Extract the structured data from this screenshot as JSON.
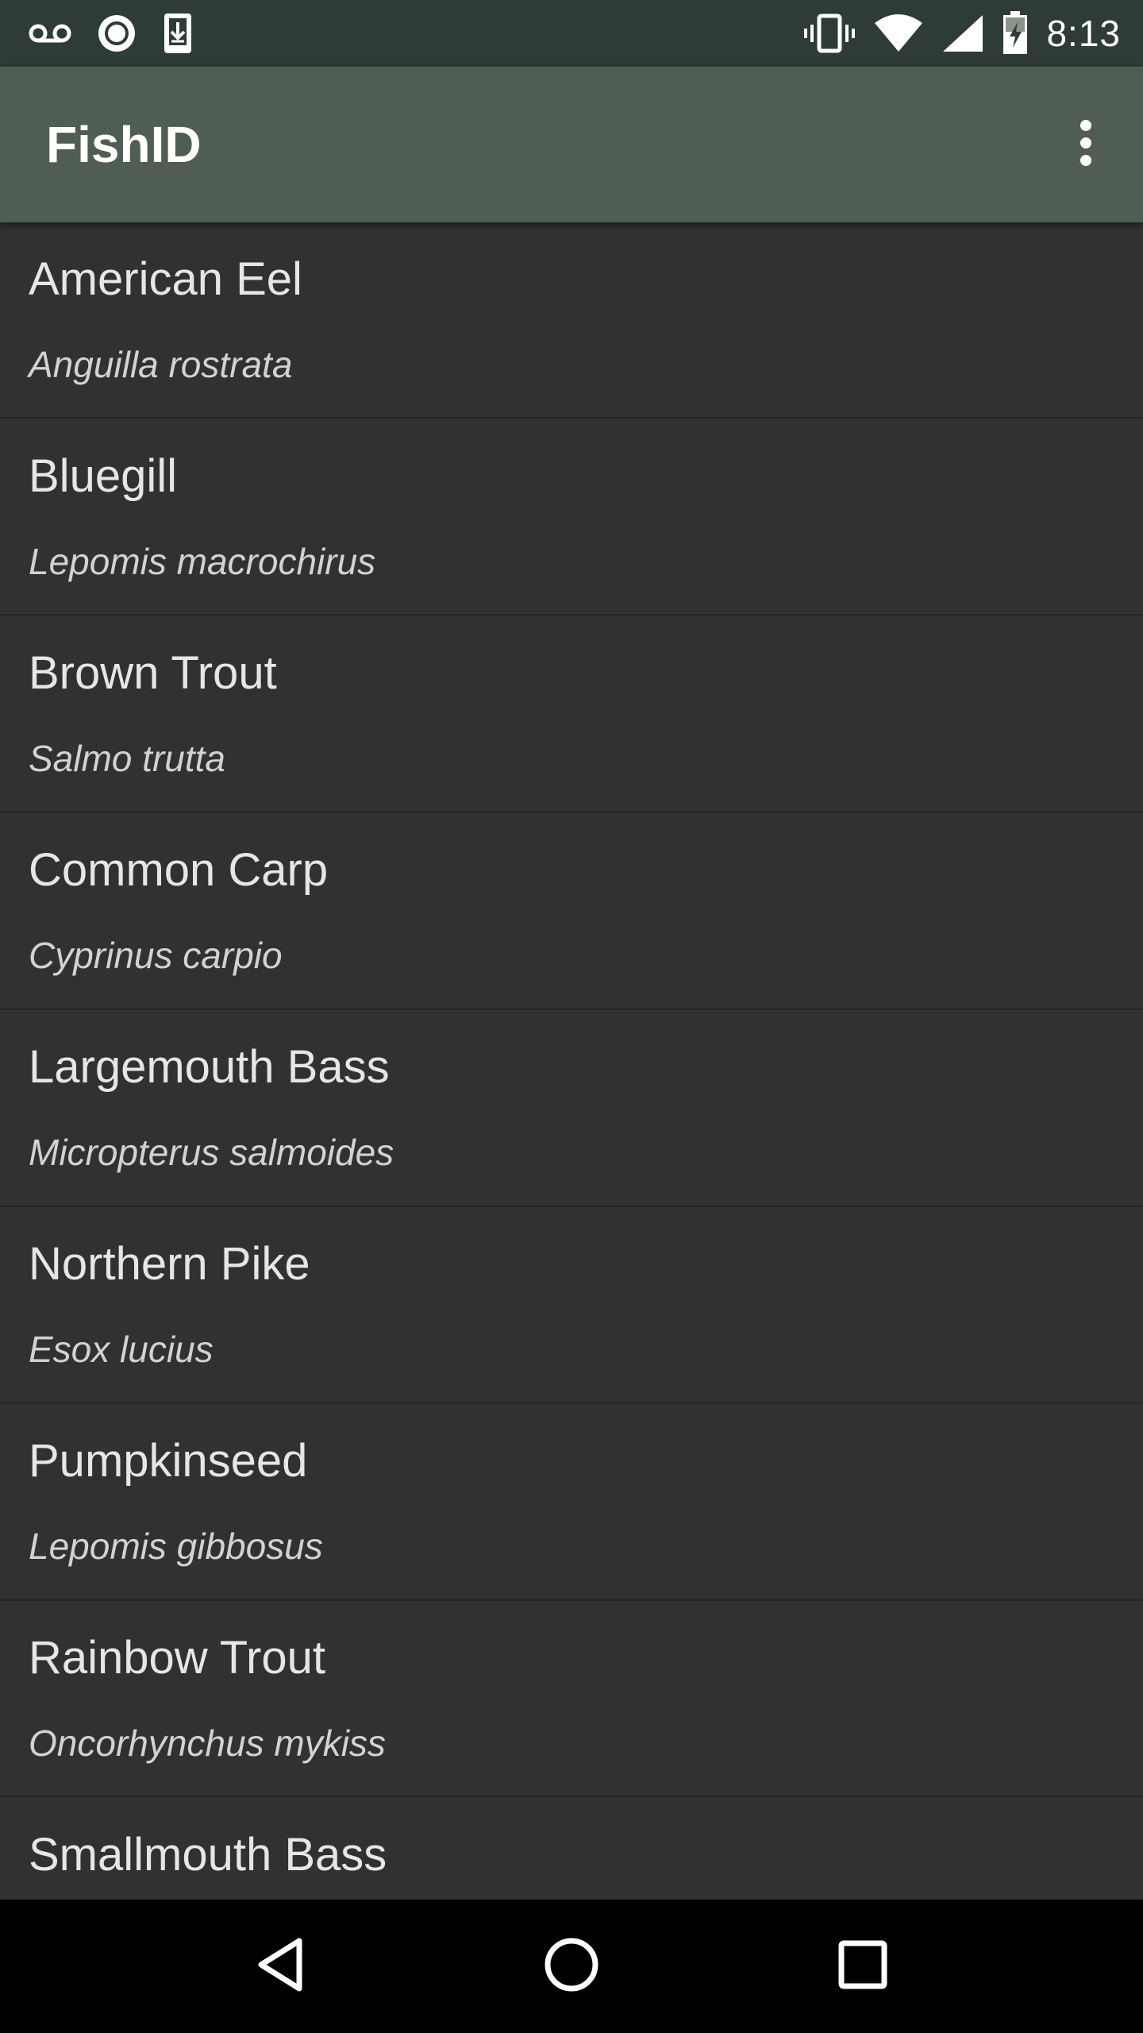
{
  "status_bar": {
    "time": "8:13",
    "left_icons": [
      "voicemail-icon",
      "record-icon",
      "download-icon"
    ],
    "right_icons": [
      "vibrate-icon",
      "wifi-icon",
      "signal-icon",
      "battery-charging-icon"
    ]
  },
  "app_bar": {
    "title": "FishID",
    "menu_icon": "more-vert-icon"
  },
  "fish_list": [
    {
      "common": "American Eel",
      "scientific": "Anguilla rostrata"
    },
    {
      "common": "Bluegill",
      "scientific": "Lepomis macrochirus"
    },
    {
      "common": "Brown Trout",
      "scientific": "Salmo trutta"
    },
    {
      "common": "Common Carp",
      "scientific": "Cyprinus carpio"
    },
    {
      "common": "Largemouth Bass",
      "scientific": "Micropterus salmoides"
    },
    {
      "common": "Northern Pike",
      "scientific": "Esox lucius"
    },
    {
      "common": "Pumpkinseed",
      "scientific": "Lepomis gibbosus"
    },
    {
      "common": "Rainbow Trout",
      "scientific": "Oncorhynchus mykiss"
    },
    {
      "common": "Smallmouth Bass",
      "scientific": ""
    }
  ],
  "nav_bar": {
    "buttons": [
      "back-icon",
      "home-icon",
      "recents-icon"
    ]
  },
  "colors": {
    "status_bar_bg": "#2f3b35",
    "app_bar_bg": "#4f5d52",
    "list_bg": "#303230",
    "divider": "#272927",
    "primary_text": "#e6e6e6",
    "secondary_text": "#d2d2d2"
  }
}
